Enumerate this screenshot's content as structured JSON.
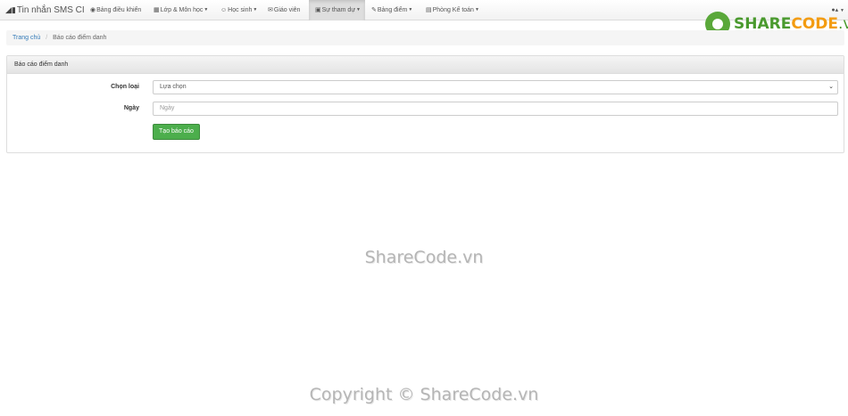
{
  "navbar": {
    "brand": "Tin nhắn SMS CI",
    "brand_icon": "signal-icon",
    "items": [
      {
        "label": "Bảng điều khiển",
        "icon": "dashboard-icon",
        "dropdown": false,
        "active": false
      },
      {
        "label": "Lớp & Môn học",
        "icon": "grid-icon",
        "dropdown": true,
        "active": false
      },
      {
        "label": "Học sinh",
        "icon": "student-icon",
        "dropdown": true,
        "active": false
      },
      {
        "label": "Giáo viên",
        "icon": "chat-icon",
        "dropdown": false,
        "active": false
      },
      {
        "label": "Sự tham dự",
        "icon": "calendar-icon",
        "dropdown": true,
        "active": true
      },
      {
        "label": "Bảng điểm",
        "icon": "edit-icon",
        "dropdown": true,
        "active": false
      },
      {
        "label": "Phòng Kế toán",
        "icon": "briefcase-icon",
        "dropdown": true,
        "active": false
      }
    ],
    "user_icon": "user-icon"
  },
  "logo": {
    "brand_a": "SHARE",
    "brand_b": "CODE",
    "brand_c": ".vn"
  },
  "breadcrumb": {
    "home": "Trang chủ",
    "current": "Báo cáo điểm danh"
  },
  "panel": {
    "heading": "Báo cáo điểm danh",
    "select_label": "Chọn loại",
    "select_value": "Lựa chọn",
    "date_label": "Ngày",
    "date_placeholder": "Ngày",
    "submit_label": "Tạo báo cáo"
  },
  "watermarks": {
    "center": "ShareCode.vn",
    "bottom": "Copyright © ShareCode.vn"
  }
}
